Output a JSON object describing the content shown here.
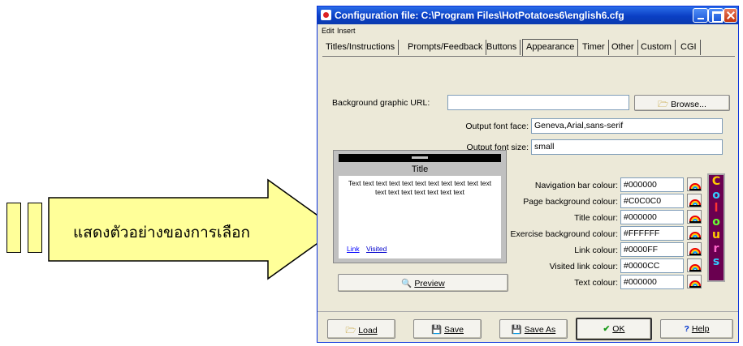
{
  "annotation": {
    "text": "แสดงตัวอย่างของการเลือก",
    "fill": "#ffff99"
  },
  "window": {
    "title": "Configuration file: C:\\Program Files\\HotPotatoes6\\english6.cfg"
  },
  "menu": [
    "Edit",
    "Insert"
  ],
  "tabs": [
    "Titles/Instructions",
    "Prompts/Feedback",
    "Buttons",
    "Appearance",
    "Timer",
    "Other",
    "Custom",
    "CGI"
  ],
  "active_tab": "Appearance",
  "bg_graphic": {
    "label": "Background graphic URL:",
    "value": "",
    "browse": "Browse..."
  },
  "font_face": {
    "label": "Output font face:",
    "value": "Geneva,Arial,sans-serif"
  },
  "font_size": {
    "label": "Output font size:",
    "value": "small"
  },
  "preview": {
    "title": "Title",
    "text": "Text text text text text text text text text text text text text text text text text text",
    "link": "Link",
    "visited": "Visited",
    "button": "Preview"
  },
  "colours": [
    {
      "label": "Navigation bar colour:",
      "value": "#000000"
    },
    {
      "label": "Page background colour:",
      "value": "#C0C0C0"
    },
    {
      "label": "Title colour:",
      "value": "#000000"
    },
    {
      "label": "Exercise background colour:",
      "value": "#FFFFFF"
    },
    {
      "label": "Link colour:",
      "value": "#0000FF"
    },
    {
      "label": "Visited link colour:",
      "value": "#0000CC"
    },
    {
      "label": "Text colour:",
      "value": "#000000"
    }
  ],
  "colours_banner": [
    "C",
    "o",
    "l",
    "o",
    "u",
    "r",
    "s"
  ],
  "colours_banner_colors": [
    "#ffcc00",
    "#33ccff",
    "#ff3333",
    "#66ff33",
    "#ffcc00",
    "#ff66cc",
    "#33ccff"
  ],
  "buttons": {
    "load": "Load",
    "save": "Save",
    "save_as": "Save As",
    "ok": "OK",
    "help": "Help"
  }
}
